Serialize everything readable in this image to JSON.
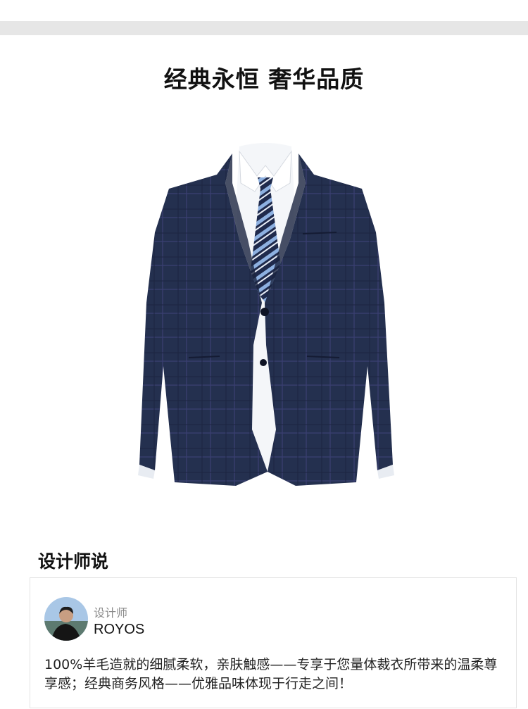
{
  "headline": "经典永恒  奢华品质",
  "section": {
    "title": "设计师说"
  },
  "designer": {
    "role": "设计师",
    "name": "ROYOS",
    "quote": "100%羊毛造就的细腻柔软，亲肤触感——专享于您量体裁衣所带来的温柔尊享感；经典商务风格——优雅品味体现于行走之间！"
  },
  "colors": {
    "suit": "#23304f",
    "shirt": "#f4f6f9",
    "tie_stripe": "#8db0e0",
    "strip": "#e6e6e6"
  }
}
